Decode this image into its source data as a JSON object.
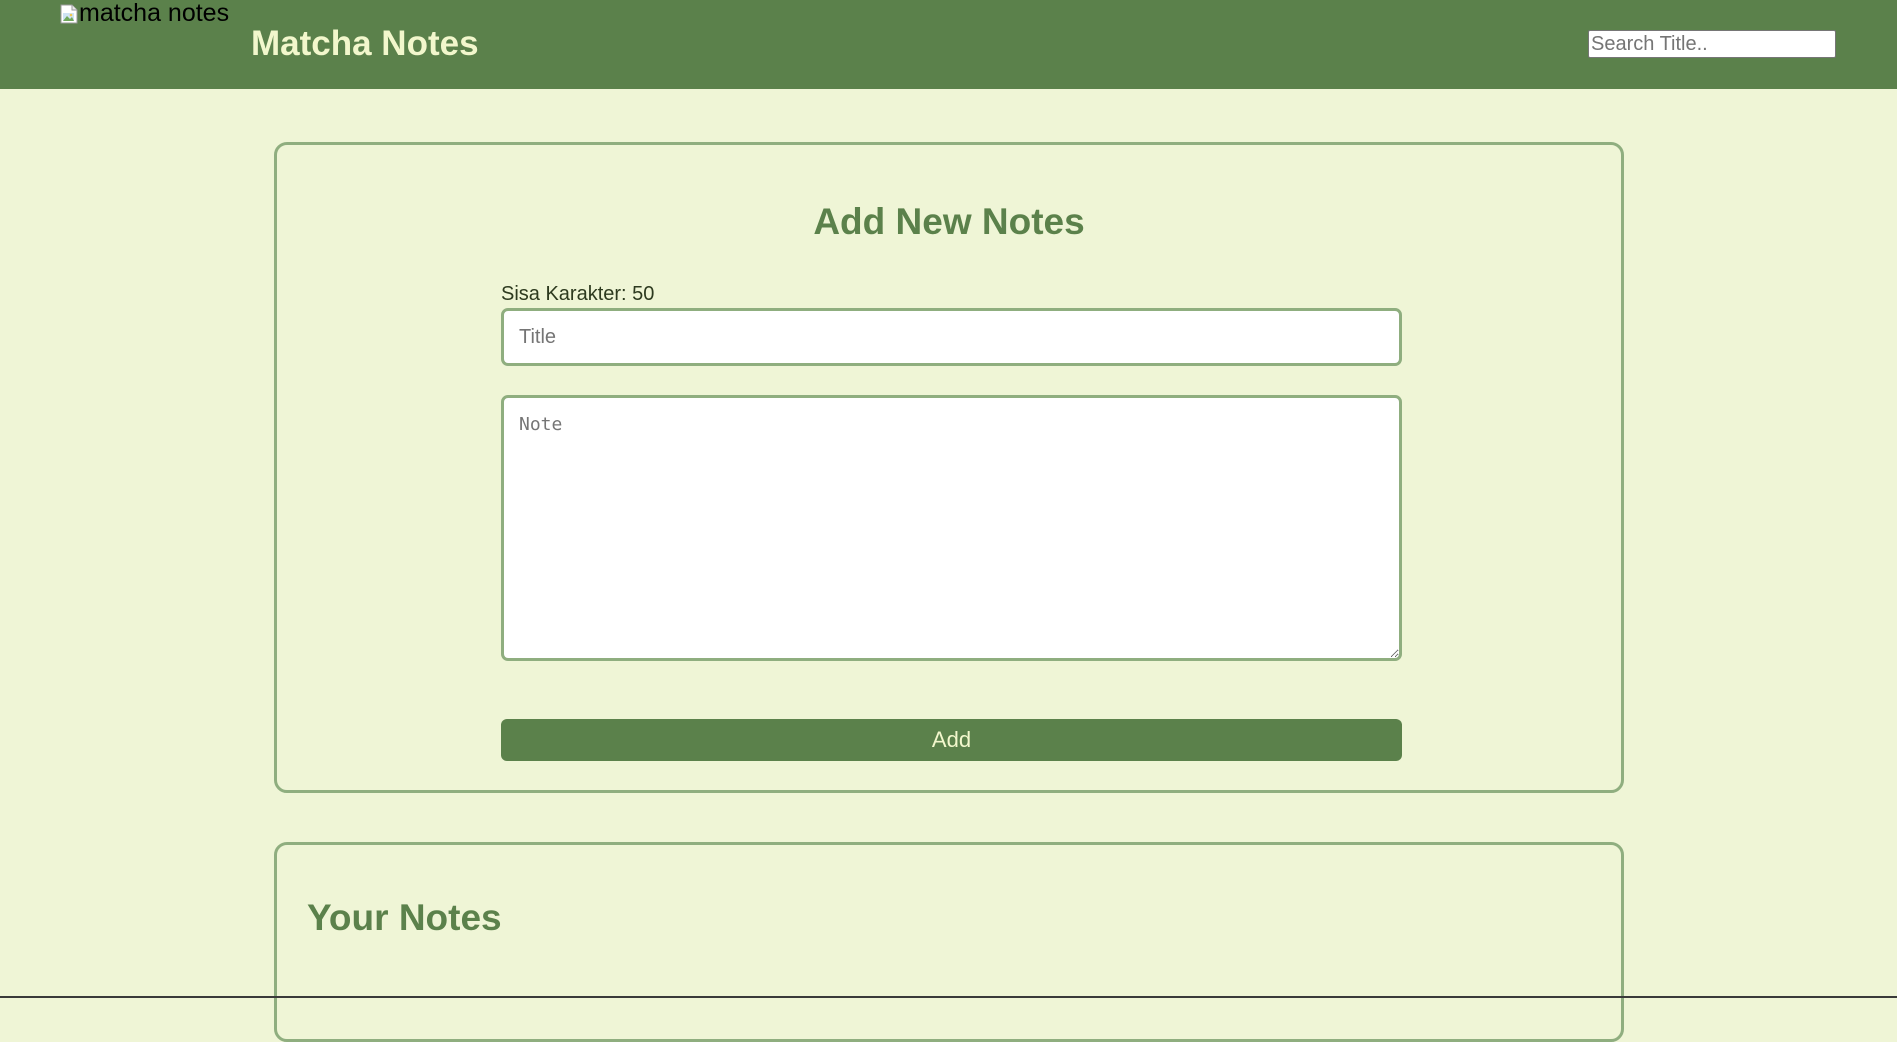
{
  "header": {
    "logo_alt": "matcha notes",
    "brand_title": "Matcha Notes",
    "search_placeholder": "Search Title.."
  },
  "add_notes": {
    "heading": "Add New Notes",
    "char_counter": "Sisa Karakter: 50",
    "title_placeholder": "Title",
    "note_placeholder": "Note",
    "add_button_label": "Add"
  },
  "your_notes": {
    "heading": "Your Notes"
  },
  "colors": {
    "header_bg": "#5B814B",
    "page_bg": "#EFF5D6",
    "brand_text": "#F2F7CC",
    "accent_green": "#5B814B",
    "border_green": "#8FAE7F"
  },
  "icons": {
    "logo": "broken-image-icon"
  }
}
